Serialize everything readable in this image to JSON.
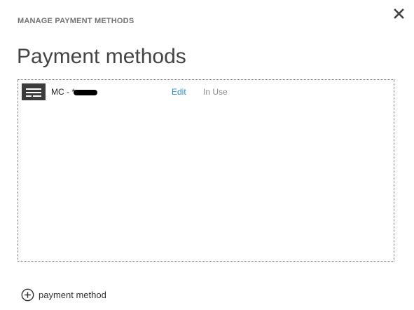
{
  "dialog": {
    "header": "MANAGE PAYMENT METHODS",
    "close_icon": "close-icon",
    "title": "Payment methods"
  },
  "methods": [
    {
      "icon": "credit-card-icon",
      "name": "MC - *",
      "edit_label": "Edit",
      "status": "In Use"
    }
  ],
  "add_method": {
    "icon": "plus-circle-icon",
    "label": "payment method"
  },
  "colors": {
    "link": "#2a8fd0",
    "header": "#737373",
    "title": "#444444",
    "status": "#8a8a8a"
  }
}
